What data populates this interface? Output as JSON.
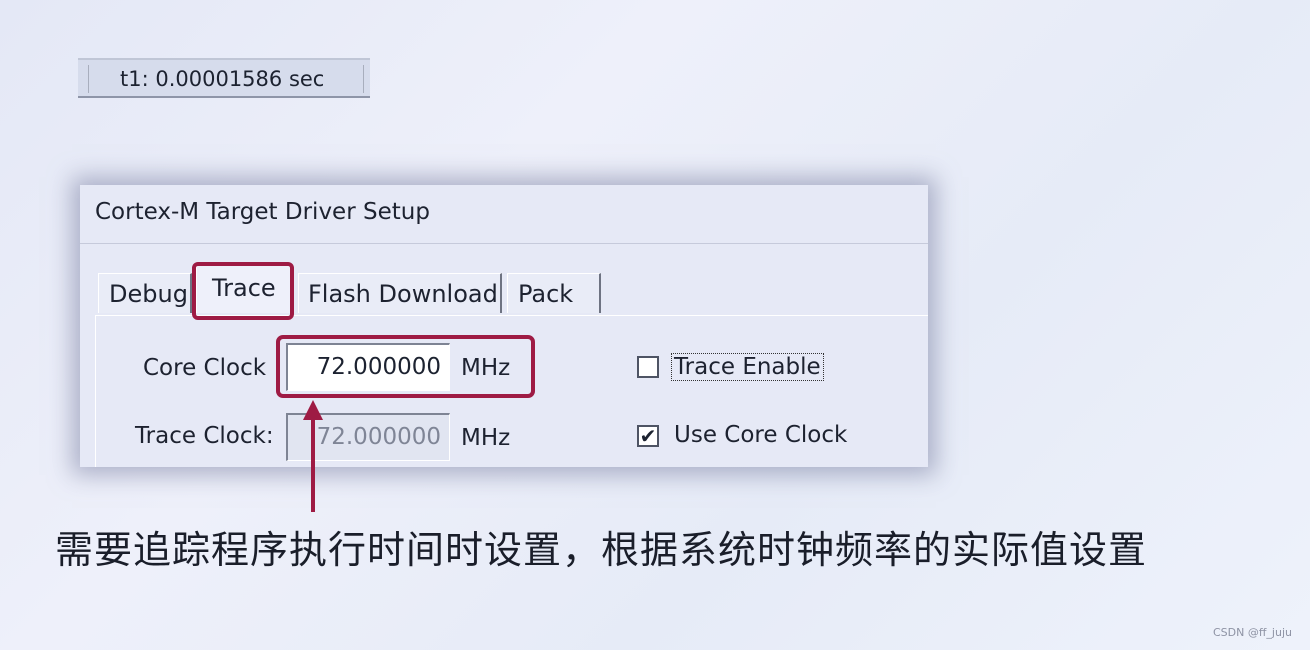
{
  "status": {
    "t1_readout": "t1: 0.00001586 sec"
  },
  "dialog": {
    "title": "Cortex-M Target Driver Setup",
    "tabs": [
      {
        "label": "Debug",
        "active": false
      },
      {
        "label": "Trace",
        "active": true
      },
      {
        "label": "Flash Download",
        "active": false
      },
      {
        "label": "Pack",
        "active": false
      }
    ],
    "core_clock": {
      "label": "Core Clock",
      "value": "72.000000",
      "unit": "MHz"
    },
    "trace_clock": {
      "label": "Trace Clock:",
      "value": "72.000000",
      "unit": "MHz"
    },
    "trace_enable": {
      "label": "Trace Enable",
      "checked": false
    },
    "use_core_clock": {
      "label": "Use Core Clock",
      "checked": true
    }
  },
  "annotation": {
    "text": "需要追踪程序执行时间时设置，根据系统时钟频率的实际值设置",
    "color": "#9e1b44"
  },
  "watermark": "CSDN @ff_juju"
}
